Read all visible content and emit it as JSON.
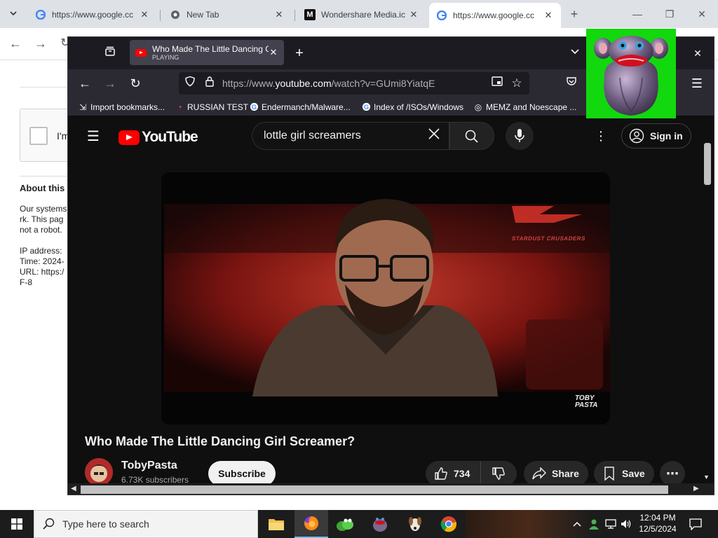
{
  "chrome": {
    "tabs": [
      {
        "title": "https://www.google.cc"
      },
      {
        "title": "New Tab"
      },
      {
        "title": "Wondershare Media.ic"
      },
      {
        "title": "https://www.google.cc"
      }
    ]
  },
  "background_page": {
    "checkbox_label": "I'm",
    "about_heading": "About this",
    "lines": [
      "Our systems",
      "rk. This pag",
      "not a robot."
    ],
    "info_lines": [
      "IP address:",
      "Time: 2024-",
      "URL: https:/",
      "F-8"
    ]
  },
  "firefox": {
    "tab": {
      "title": "Who Made The Little Dancing G",
      "status": "PLAYING"
    },
    "url": {
      "prefix": "https://www.",
      "host": "youtube.com",
      "path": "/watch?v=GUmi8YiatqE"
    },
    "bookmarks": [
      {
        "label": "Import bookmarks...",
        "icon": "import-icon"
      },
      {
        "label": "RUSSIAN TEST",
        "icon": "search-icon"
      },
      {
        "label": "Endermanch/Malware...",
        "icon": "google-icon"
      },
      {
        "label": "Index of /ISOs/Windows",
        "icon": "google-icon"
      },
      {
        "label": "MEMZ and Noescape ...",
        "icon": "globe-icon"
      }
    ]
  },
  "youtube": {
    "logo_text": "YouTube",
    "search_query": "lottle girl screamers",
    "sign_in": "Sign in",
    "video_title": "Who Made The Little Dancing Girl Screamer?",
    "channel_name": "TobyPasta",
    "subscribers": "6.73K subscribers",
    "subscribe_label": "Subscribe",
    "likes": "734",
    "share_label": "Share",
    "save_label": "Save",
    "video_banner": "STARDUST CRUSADERS",
    "video_watermark": "TOBY PASTA"
  },
  "taskbar": {
    "search_placeholder": "Type here to search",
    "time": "12:04 PM",
    "date": "12/5/2024"
  },
  "colors": {
    "youtube_red": "#ff0000",
    "sticker_green": "#12d80e",
    "firefox_toolbar": "#2b2a33"
  }
}
